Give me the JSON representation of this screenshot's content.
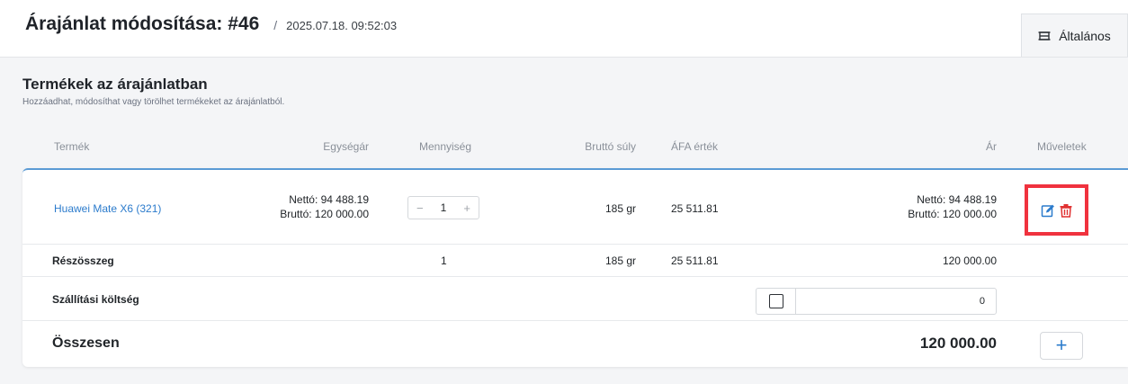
{
  "header": {
    "title": "Árajánlat módosítása: #46",
    "separator": "/",
    "timestamp": "2025.07.18. 09:52:03"
  },
  "tabs": [
    {
      "label": "Általános",
      "icon": "layout-icon"
    }
  ],
  "section": {
    "title": "Termékek az árajánlatban",
    "subtitle": "Hozzáadhat, módosíthat vagy törölhet termékeket az árajánlatból."
  },
  "columns": {
    "product": "Termék",
    "unit_price": "Egységár",
    "quantity": "Mennyiség",
    "gross_weight": "Bruttó súly",
    "vat_value": "ÁFA érték",
    "price": "Ár",
    "actions": "Műveletek"
  },
  "items": [
    {
      "product": "Huawei Mate X6 (321)",
      "unit_net": "Nettó: 94 488.19",
      "unit_gross": "Bruttó: 120 000.00",
      "quantity": "1",
      "qty_minus": "−",
      "qty_plus": "+",
      "weight": "185 gr",
      "vat": "25 511.81",
      "price_net": "Nettó: 94 488.19",
      "price_gross": "Bruttó: 120 000.00",
      "actions": [
        "edit-icon",
        "trash-icon"
      ]
    }
  ],
  "subtotal": {
    "label": "Részösszeg",
    "quantity": "1",
    "weight": "185 gr",
    "vat": "25 511.81",
    "price": "120 000.00"
  },
  "shipping": {
    "label": "Szállítási költség",
    "value": "0"
  },
  "total": {
    "label": "Összesen",
    "value": "120 000.00",
    "add_label": "+"
  },
  "colors": {
    "link": "#2b7bcc",
    "accent_border": "#5b9bd5",
    "highlight": "#f0323e",
    "delete": "#e03131"
  }
}
